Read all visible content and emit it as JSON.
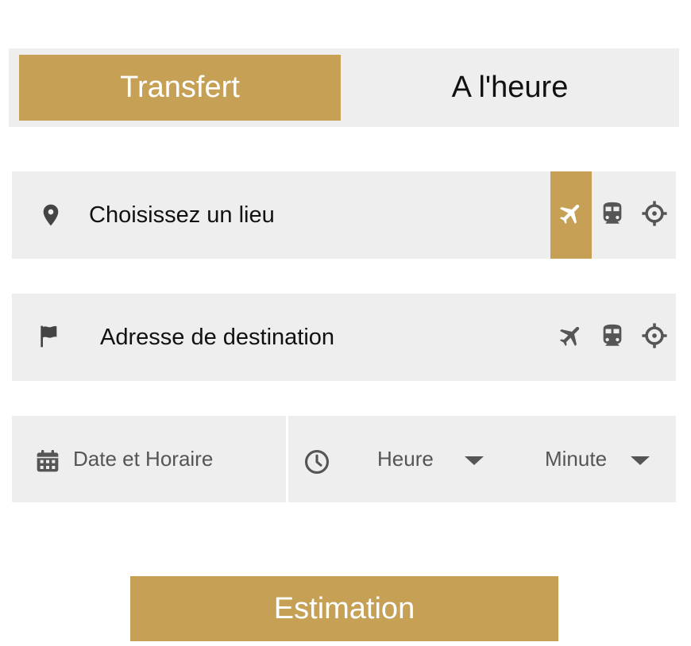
{
  "tabs": [
    {
      "label": "Transfert",
      "active": true
    },
    {
      "label": "A l'heure",
      "active": false
    }
  ],
  "pickup": {
    "icon": "map-marker-icon",
    "placeholder": "Choisissez un lieu",
    "actions": [
      "plane-icon",
      "train-icon",
      "crosshair-icon"
    ],
    "active_action": "plane-icon"
  },
  "destination": {
    "icon": "flag-icon",
    "placeholder": "Adresse de destination",
    "actions": [
      "plane-icon",
      "train-icon",
      "crosshair-icon"
    ]
  },
  "datetime": {
    "date_icon": "calendar-icon",
    "date_placeholder": "Date et Horaire",
    "time_icon": "clock-icon",
    "hour_placeholder": "Heure",
    "minute_placeholder": "Minute"
  },
  "submit_label": "Estimation",
  "colors": {
    "accent": "#c5a055",
    "field_bg": "#eeeeee",
    "icon": "#555555"
  }
}
